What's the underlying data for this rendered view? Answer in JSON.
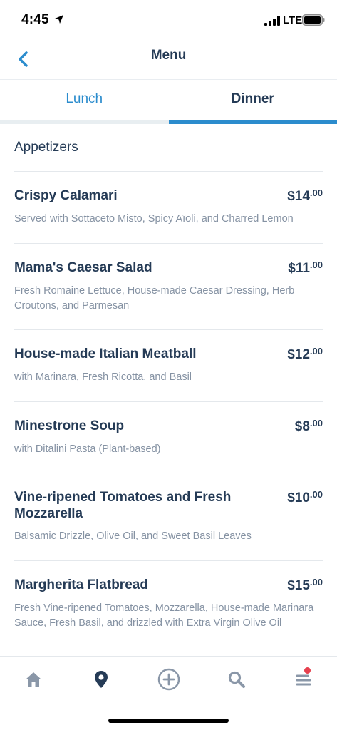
{
  "status_bar": {
    "time": "4:45",
    "network": "LTE",
    "icons": [
      "location-arrow-icon",
      "signal-icon",
      "battery-icon"
    ]
  },
  "header": {
    "title": "Menu",
    "back_icon": "chevron-left-icon"
  },
  "tabs": [
    {
      "label": "Lunch",
      "selected": false
    },
    {
      "label": "Dinner",
      "selected": true
    }
  ],
  "section": {
    "title": "Appetizers"
  },
  "items": [
    {
      "name": "Crispy Calamari",
      "price_dollars": "$14",
      "price_cents": ".00",
      "description": "Served with Sottaceto Misto, Spicy Aïoli, and Charred Lemon"
    },
    {
      "name": "Mama's Caesar Salad",
      "price_dollars": "$11",
      "price_cents": ".00",
      "description": "Fresh Romaine Lettuce, House-made Caesar Dressing, Herb Croutons, and Parmesan"
    },
    {
      "name": "House-made Italian Meatball",
      "price_dollars": "$12",
      "price_cents": ".00",
      "description": "with Marinara, Fresh Ricotta, and Basil"
    },
    {
      "name": "Minestrone Soup",
      "price_dollars": "$8",
      "price_cents": ".00",
      "description": "with Ditalini Pasta (Plant-based)"
    },
    {
      "name": "Vine-ripened Tomatoes and Fresh Mozzarella",
      "price_dollars": "$10",
      "price_cents": ".00",
      "description": "Balsamic Drizzle, Olive Oil, and Sweet Basil Leaves"
    },
    {
      "name": "Margherita Flatbread",
      "price_dollars": "$15",
      "price_cents": ".00",
      "description": "Fresh Vine-ripened Tomatoes, Mozzarella, House-made Marinara Sauce, Fresh Basil, and drizzled with Extra Virgin Olive Oil"
    }
  ],
  "tab_bar": {
    "icons": [
      "home-icon",
      "map-pin-icon",
      "add-circle-icon",
      "search-icon",
      "menu-icon"
    ],
    "selected": "map-pin-icon",
    "notification_badge": true
  },
  "colors": {
    "accent": "#2b8ccd",
    "text_primary": "#253b56",
    "text_secondary": "#8592a3",
    "icon_inactive": "#8a97a8",
    "badge": "#e6404e"
  }
}
